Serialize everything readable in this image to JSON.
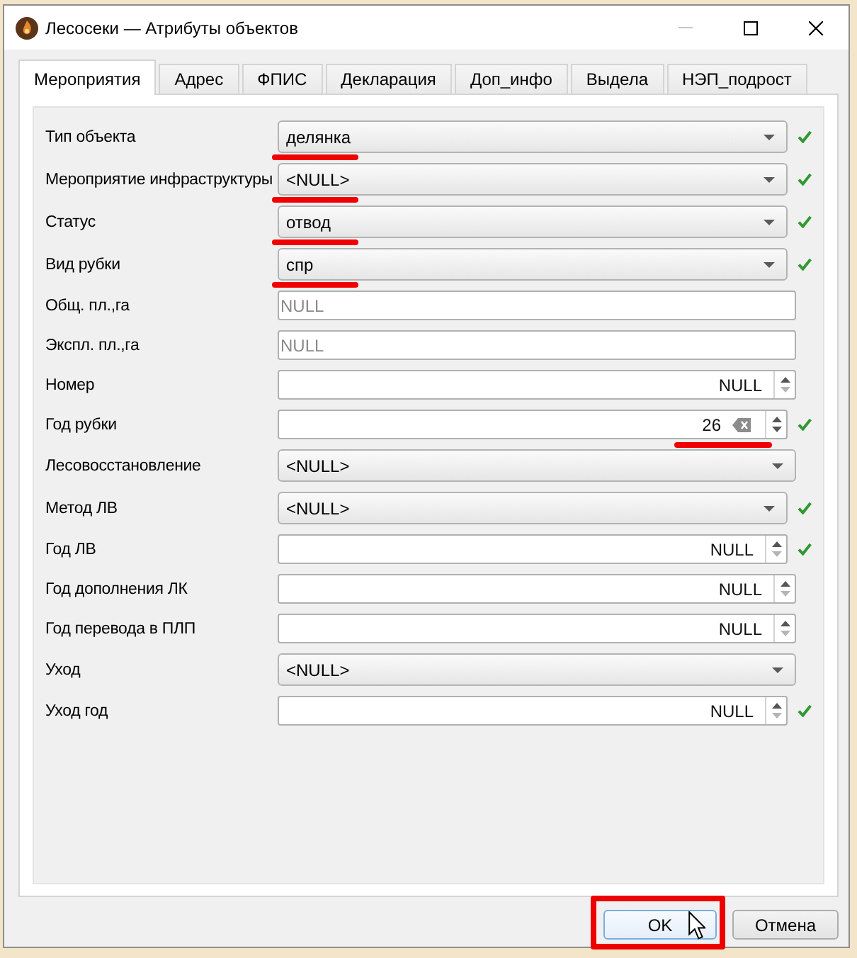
{
  "window": {
    "title": "Лесосеки — Атрибуты объектов",
    "controls": [
      {
        "kind": "minimize",
        "disabled": true
      },
      {
        "kind": "maximize",
        "disabled": false
      },
      {
        "kind": "close",
        "disabled": false
      }
    ]
  },
  "tabs": [
    {
      "label": "Мероприятия",
      "selected": true
    },
    {
      "label": "Адрес",
      "selected": false
    },
    {
      "label": "ФПИС",
      "selected": false
    },
    {
      "label": "Декларация",
      "selected": false
    },
    {
      "label": "Доп_инфо",
      "selected": false
    },
    {
      "label": "Выдела",
      "selected": false
    },
    {
      "label": "НЭП_подрост",
      "selected": false
    }
  ],
  "form": {
    "rows": [
      {
        "kind": "combo",
        "label": "Тип объекта",
        "value": "делянка",
        "check_mark": true,
        "marked": true
      },
      {
        "kind": "combo",
        "label": "Мероприятие инфраструктуры",
        "value": "<NULL>",
        "check_mark": true,
        "marked": true
      },
      {
        "kind": "combo",
        "label": "Статус",
        "value": "отвод",
        "check_mark": true,
        "marked": true
      },
      {
        "kind": "combo",
        "label": "Вид рубки",
        "value": "спр",
        "check_mark": true,
        "marked": true
      },
      {
        "kind": "text",
        "label": "Общ. пл.,га",
        "placeholder": "NULL",
        "check_mark": false,
        "marked": false
      },
      {
        "kind": "text",
        "label": "Экспл. пл.,га",
        "placeholder": "NULL",
        "check_mark": false,
        "marked": false
      },
      {
        "kind": "spin",
        "label": "Номер",
        "value": "NULL",
        "clear_button": false,
        "down_disabled": true,
        "check_mark": false,
        "marked": false
      },
      {
        "kind": "spin",
        "label": "Год рубки",
        "value": "26",
        "clear_button": true,
        "down_disabled": false,
        "check_mark": true,
        "marked": true
      },
      {
        "kind": "combo",
        "label": "Лесовосстановление",
        "value": "<NULL>",
        "check_mark": false,
        "marked": false
      },
      {
        "kind": "combo",
        "label": "Метод ЛВ",
        "value": "<NULL>",
        "check_mark": true,
        "marked": false
      },
      {
        "kind": "spin",
        "label": "Год ЛВ",
        "value": "NULL",
        "clear_button": false,
        "down_disabled": true,
        "check_mark": true,
        "marked": false
      },
      {
        "kind": "spin",
        "label": "Год дополнения ЛК",
        "value": "NULL",
        "clear_button": false,
        "down_disabled": true,
        "check_mark": false,
        "marked": false
      },
      {
        "kind": "spin",
        "label": "Год перевода в ПЛП",
        "value": "NULL",
        "clear_button": false,
        "down_disabled": true,
        "check_mark": false,
        "marked": false
      },
      {
        "kind": "combo",
        "label": "Уход",
        "value": "<NULL>",
        "check_mark": false,
        "marked": false
      },
      {
        "kind": "spin",
        "label": "Уход год",
        "value": "NULL",
        "clear_button": false,
        "down_disabled": true,
        "check_mark": true,
        "marked": false
      }
    ]
  },
  "buttons": [
    {
      "label": "OK",
      "default": true,
      "marked": true,
      "pointer": true
    },
    {
      "label": "Отмена",
      "default": false,
      "marked": false,
      "pointer": false
    }
  ]
}
